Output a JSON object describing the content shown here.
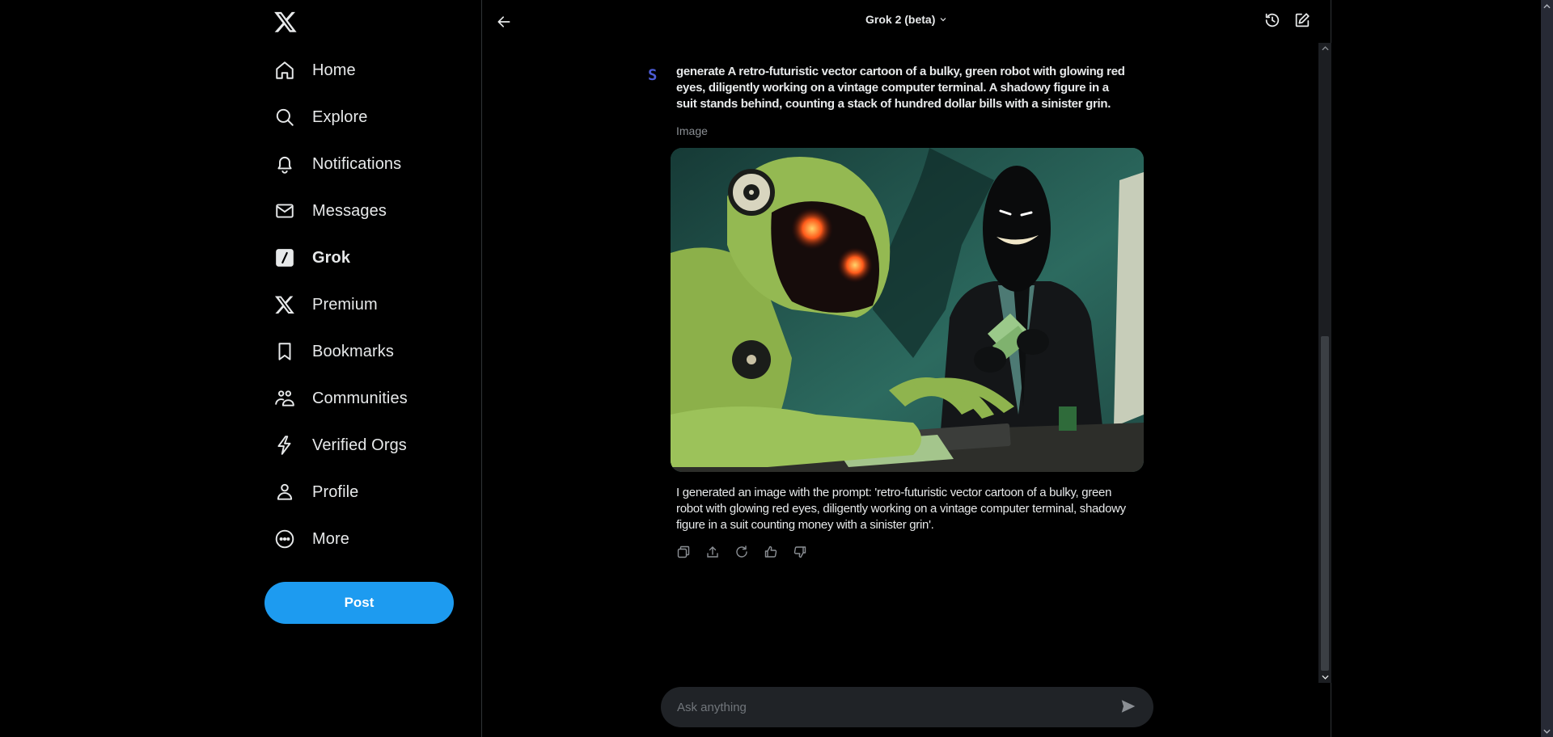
{
  "sidebar": {
    "logo": "x-logo",
    "items": [
      {
        "label": "Home",
        "icon": "home-icon"
      },
      {
        "label": "Explore",
        "icon": "search-icon"
      },
      {
        "label": "Notifications",
        "icon": "bell-icon"
      },
      {
        "label": "Messages",
        "icon": "envelope-icon"
      },
      {
        "label": "Grok",
        "icon": "grok-icon",
        "active": true
      },
      {
        "label": "Premium",
        "icon": "x-icon"
      },
      {
        "label": "Bookmarks",
        "icon": "bookmark-icon"
      },
      {
        "label": "Communities",
        "icon": "communities-icon"
      },
      {
        "label": "Verified Orgs",
        "icon": "lightning-icon"
      },
      {
        "label": "Profile",
        "icon": "person-icon"
      },
      {
        "label": "More",
        "icon": "more-circle-icon"
      }
    ],
    "post_label": "Post"
  },
  "header": {
    "model": "Grok 2 (beta)"
  },
  "conversation": {
    "user_avatar": "S",
    "user_prompt": "generate A retro-futuristic vector cartoon of a bulky, green robot with glowing red eyes, diligently working on a vintage computer terminal. A shadowy figure in a suit stands behind, counting a stack of hundred dollar bills with a sinister grin.",
    "image_label": "Image",
    "image_alt": "Green robot with glowing red eyes typing at a terminal while a shadowy grinning figure in a suit counts money",
    "reply": "I generated an image with the prompt: 'retro-futuristic vector cartoon of a bulky, green robot with glowing red eyes, diligently working on a vintage computer terminal, shadowy figure in a suit counting money with a sinister grin'.",
    "actions": [
      "copy",
      "share",
      "regenerate",
      "like",
      "dislike"
    ]
  },
  "composer": {
    "placeholder": "Ask anything"
  },
  "colors": {
    "accent": "#1d9bf0",
    "avatar": "#4c5bd4",
    "input_bg": "#202327"
  }
}
